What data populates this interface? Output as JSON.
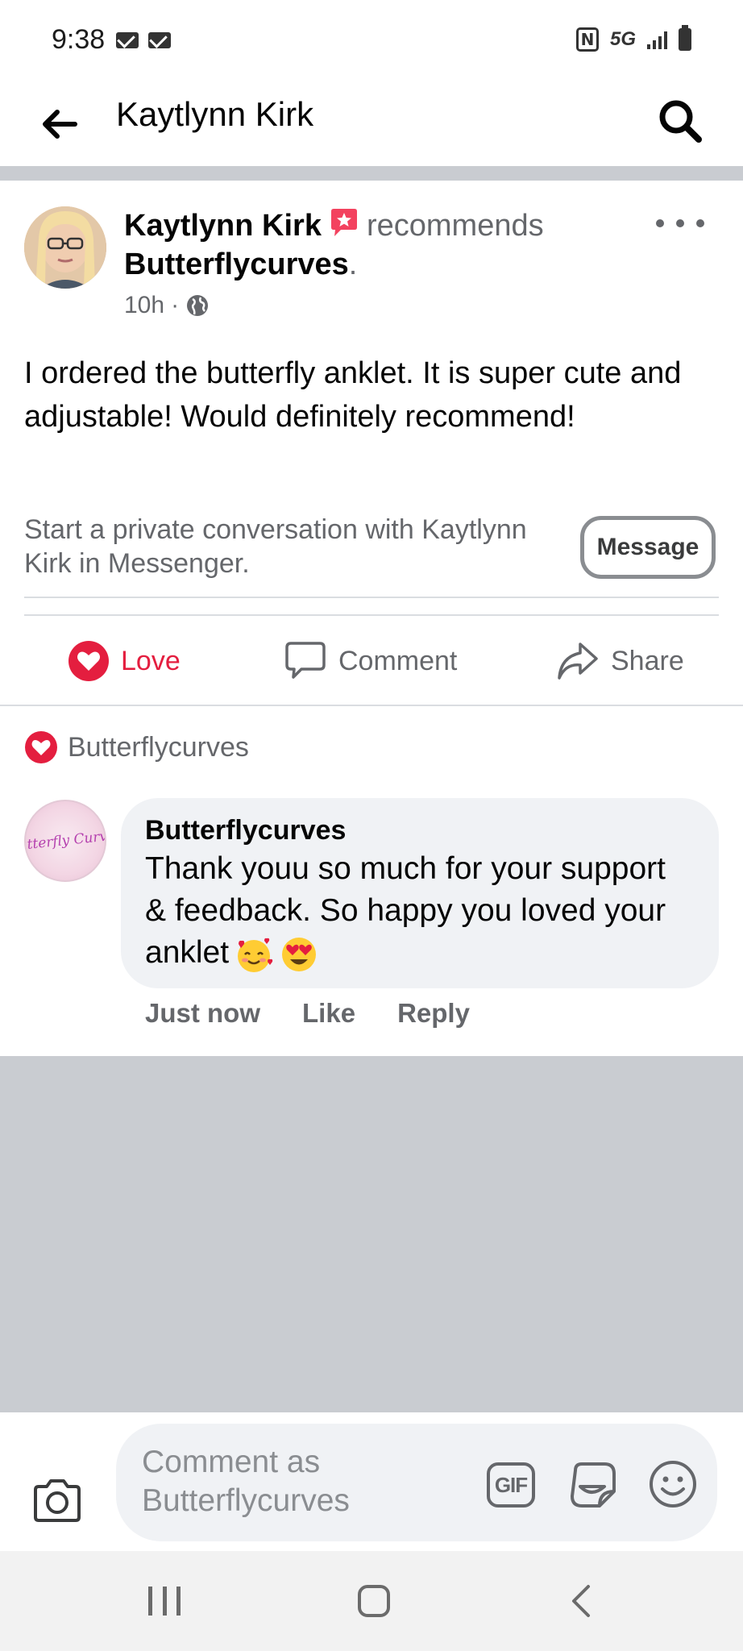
{
  "status_bar": {
    "time": "9:38",
    "network": "5G",
    "icons": [
      "mail-icon",
      "mail-icon",
      "nfc-icon",
      "signal-icon",
      "battery-icon"
    ]
  },
  "header": {
    "title": "Kaytlynn Kirk",
    "back_icon": "arrow-left-icon",
    "search_icon": "search-icon"
  },
  "post": {
    "author": "Kaytlynn Kirk",
    "recommends_word": "recommends",
    "page": "Butterflycurves",
    "period": ".",
    "time": "10h",
    "separator": "·",
    "privacy_icon": "globe-icon",
    "body": "I ordered the butterfly anklet. It is super cute and adjustable! Would definitely recommend!",
    "private_conversation": "Start a private conversation with Kaytlynn Kirk in Messenger.",
    "message_button": "Message"
  },
  "actions": {
    "love": "Love",
    "comment": "Comment",
    "share": "Share"
  },
  "reactions": {
    "reactor": "Butterflycurves"
  },
  "comment": {
    "avatar_text": "Butterfly Curves",
    "author": "Butterflycurves",
    "text": "Thank youu so much for your support & feedback. So happy you loved your anklet",
    "emojis": [
      "smiling-face-with-hearts",
      "heart-eyes"
    ],
    "time": "Just now",
    "like": "Like",
    "reply": "Reply"
  },
  "composer": {
    "placeholder": "Comment as Butterflycurves",
    "gif_label": "GIF"
  },
  "colors": {
    "love_red": "#e41e3f",
    "secondary_text": "#65676b",
    "bubble_bg": "#f0f2f5",
    "divider_gray": "#c9ccd1"
  }
}
